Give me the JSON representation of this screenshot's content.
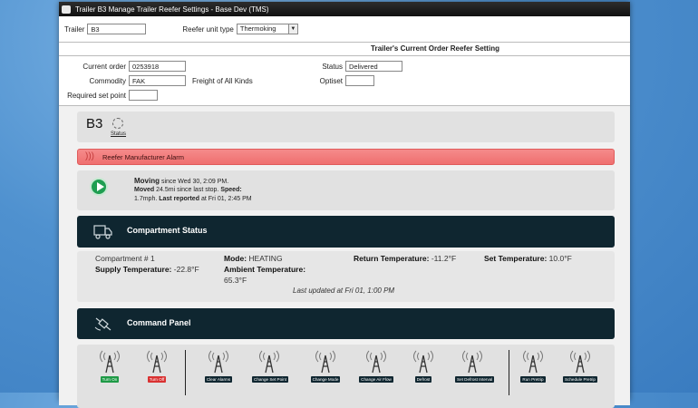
{
  "window": {
    "title": "Trailer B3 Manage Trailer Reefer Settings - Base Dev (TMS)"
  },
  "header": {
    "trailer_label": "Trailer",
    "trailer_value": "B3",
    "reefer_unit_label": "Reefer unit type",
    "reefer_unit_value": "Thermoking"
  },
  "section_title": "Trailer's Current Order Reefer Setting",
  "order": {
    "current_order_label": "Current order",
    "current_order_value": "0253918",
    "commodity_label": "Commodity",
    "commodity_value": "FAK",
    "commodity_desc": "Freight of All Kinds",
    "required_set_point_label": "Required set point",
    "required_set_point_value": "",
    "status_label": "Status",
    "status_value": "Delivered",
    "optiset_label": "Optiset",
    "optiset_value": ""
  },
  "trailer_card": {
    "name": "B3",
    "status_link": "Status"
  },
  "alarm": {
    "text": "Reefer Manufacturer Alarm"
  },
  "moving": {
    "status": "Moving",
    "since": "since Wed 30, 2:09 PM.",
    "moved_label": "Moved",
    "moved_text": "24.5mi since last stop.",
    "speed_label": "Speed:",
    "speed_value": "1.7mph.",
    "last_reported_label": "Last reported",
    "last_reported_value": "at Fri 01, 2:45 PM"
  },
  "compartment_panel": {
    "title": "Compartment Status"
  },
  "compartment": {
    "name": "Compartment # 1",
    "mode_label": "Mode:",
    "mode_value": "HEATING",
    "return_temp_label": "Return Temperature:",
    "return_temp_value": "-11.2°F",
    "set_temp_label": "Set Temperature:",
    "set_temp_value": "10.0°F",
    "supply_temp_label": "Supply Temperature:",
    "supply_temp_value": "-22.8°F",
    "ambient_temp_label": "Ambient Temperature:",
    "ambient_temp_value": "65.3°F",
    "last_updated": "Last updated at Fri 01, 1:00 PM"
  },
  "command_panel": {
    "title": "Command Panel",
    "commands": [
      {
        "label": "Turn On",
        "color": "#1e9a46"
      },
      {
        "label": "Turn Off",
        "color": "#d93131"
      },
      {
        "label": "Clear Alarms",
        "color": "#0f2630"
      },
      {
        "label": "Change Set Point",
        "color": "#0f2630"
      },
      {
        "label": "Change Mode",
        "color": "#0f2630"
      },
      {
        "label": "Change Air Flow",
        "color": "#0f2630"
      },
      {
        "label": "Defrost",
        "color": "#0f2630"
      },
      {
        "label": "Set Defrost Interval",
        "color": "#0f2630"
      },
      {
        "label": "Run Pretrip",
        "color": "#0f2630"
      },
      {
        "label": "Schedule Pretrip",
        "color": "#0f2630"
      }
    ]
  },
  "colors": {
    "panel_dark": "#0f2630",
    "alarm": "#ef6f6f",
    "play": "#1f9e51"
  },
  "icons": [
    "app-icon",
    "alarm-wave-icon",
    "play-icon",
    "truck-icon",
    "satellite-icon",
    "tower-icon"
  ]
}
